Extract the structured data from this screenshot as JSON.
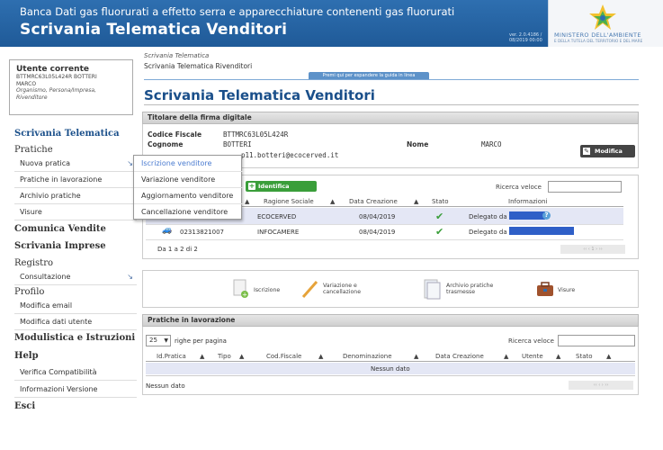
{
  "header": {
    "title_top": "Banca Dati gas fluorurati a effetto serra e apparecchiature contenenti gas fluorurati",
    "title_main": "Scrivania Telematica Venditori",
    "version": "ver. 2.0.4186 / 08/2019 00:00",
    "ministry_line1": "MINISTERO DELL'AMBIENTE",
    "ministry_line2": "E DELLA TUTELA DEL TERRITORIO E DEL MARE"
  },
  "user": {
    "heading": "Utente corrente",
    "code": "BTTMRC63L05L424R BOTTERI",
    "name": "MARCO",
    "role": "Organismo, Persona/Impresa, Rivenditore"
  },
  "nav": {
    "scrivania": "Scrivania Telematica",
    "pratiche": "Pratiche",
    "nuova_pratica": "Nuova pratica",
    "pratiche_lav": "Pratiche in lavorazione",
    "archivio": "Archivio pratiche",
    "visure": "Visure",
    "comunica": "Comunica Vendite",
    "imprese": "Scrivania Imprese",
    "registro": "Registro",
    "consultazione": "Consultazione",
    "profilo": "Profilo",
    "modifica_email": "Modifica email",
    "modifica_utente": "Modifica dati utente",
    "modulistica": "Modulistica e Istruzioni",
    "help": "Help",
    "verifica": "Verifica Compatibilità",
    "info": "Informazioni Versione",
    "esci": "Esci"
  },
  "breadcrumb": {
    "line1": "Scrivania Telematica",
    "line2": "Scrivania Telematica Rivenditori"
  },
  "guide": "Premi qui per espandere la guida in linea",
  "page_title": "Scrivania Telematica Venditori",
  "titolare": {
    "header": "Titolare della firma digitale",
    "cf_label": "Codice Fiscale",
    "cf_value": "BTTMRC63L05L424R",
    "cognome_label": "Cognome",
    "cognome_value": "BOTTERI",
    "email_value": "p11.botteri@ecocerved.it",
    "nome_label": "Nome",
    "nome_value": "MARCO",
    "modifica_btn": "Modifica dati"
  },
  "dropdown": [
    "Iscrizione venditore",
    "Variazione venditore",
    "Aggiornamento venditore",
    "Cancellazione venditore"
  ],
  "imprese": {
    "identifica_btn": "Identifica impresa",
    "ricerca_label": "Ricerca veloce",
    "columns": [
      "Ragione Sociale",
      "Data Creazione",
      "Stato",
      "Informazioni"
    ],
    "rows": [
      {
        "code": "",
        "ragione": "ECOCERVED",
        "data": "08/04/2019",
        "info": "Delegato da"
      },
      {
        "code": "02313821007",
        "ragione": "INFOCAMERE",
        "data": "08/04/2019",
        "info": "Delegato da"
      }
    ],
    "count": "Da 1 a 2 di 2"
  },
  "tiles": {
    "iscrizione": "Iscrizione",
    "variazione": "Variazione e cancellazione",
    "archivio": "Archivio pratiche trasmesse",
    "visure": "Visure"
  },
  "pratiche": {
    "header": "Pratiche in lavorazione",
    "page_size": "25",
    "righe": "righe per pagina",
    "ricerca_label": "Ricerca veloce",
    "columns": [
      "Id.Pratica",
      "Tipo",
      "Cod.Fiscale",
      "Denominazione",
      "Data Creazione",
      "Utente",
      "Stato"
    ],
    "empty_row": "Nessun dato",
    "footer": "Nessun dato"
  },
  "colors": {
    "header_blue": "#1f5a98",
    "title_blue": "#1a4f8a",
    "green": "#3a9e3a",
    "link_blue": "#4a7bd0"
  }
}
